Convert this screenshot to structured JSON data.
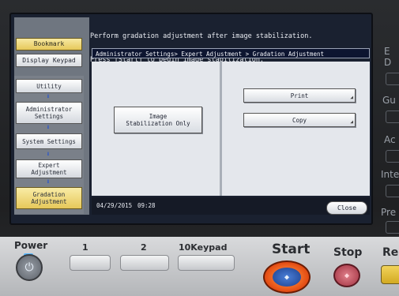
{
  "message": {
    "line1": "Perform gradation adjustment after image stabilization.",
    "line2": "Press [Start] to begin image stabilization."
  },
  "nav": {
    "bookmark": "Bookmark",
    "display_keypad": "Display Keypad",
    "items": [
      {
        "label": "Utility"
      },
      {
        "label": "Administrator\nSettings"
      },
      {
        "label": "System Settings"
      },
      {
        "label": "Expert\nAdjustment"
      },
      {
        "label": "Gradation\nAdjustment"
      }
    ]
  },
  "dialog": {
    "breadcrumb": "Administrator Settings> Expert Adjustment > Gradation Adjustment",
    "image_stabilization_label": "Image\nStabilization Only",
    "print_label": "Print",
    "copy_label": "Copy"
  },
  "status": {
    "date": "04/29/2015",
    "time": "09:28",
    "close_label": "Close"
  },
  "side_labels": [
    "E",
    "D",
    "Gu",
    "Ac",
    "Inte",
    "Pre"
  ],
  "keys": {
    "power": "Power",
    "key1": "1",
    "key2": "2",
    "keypad": "10Keypad",
    "start": "Start",
    "stop": "Stop",
    "reset": "Res"
  },
  "colors": {
    "accent_yellow": "#e6c85a",
    "start_orange": "#e24a12",
    "start_blue": "#1c3f8c",
    "stop_red": "#a03040",
    "power_led": "#4fb5ff"
  }
}
